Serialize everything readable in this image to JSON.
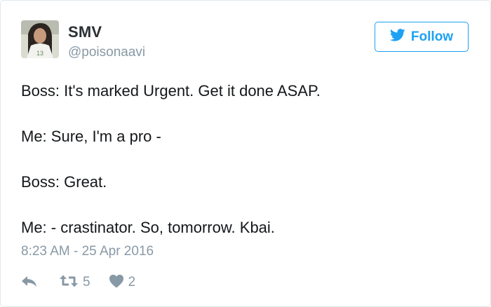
{
  "user": {
    "name": "SMV",
    "handle": "@poisonaavi",
    "avatar_jersey_number": "13"
  },
  "follow_button": {
    "label": "Follow",
    "icon": "twitter-bird-icon"
  },
  "tweet": {
    "lines": [
      "Boss: It's marked Urgent. Get it done ASAP.",
      "Me: Sure, I'm a pro -",
      "Boss: Great.",
      "Me: - crastinator. So, tomorrow. Kbai."
    ],
    "timestamp": "8:23 AM - 25 Apr 2016"
  },
  "actions": {
    "reply": {
      "icon": "reply-icon"
    },
    "retweet": {
      "icon": "retweet-icon",
      "count": "5"
    },
    "like": {
      "icon": "heart-icon",
      "count": "2"
    }
  },
  "colors": {
    "accent": "#1da1f2",
    "text": "#14171a",
    "muted": "#8899a6",
    "border": "#e1e8ed"
  }
}
